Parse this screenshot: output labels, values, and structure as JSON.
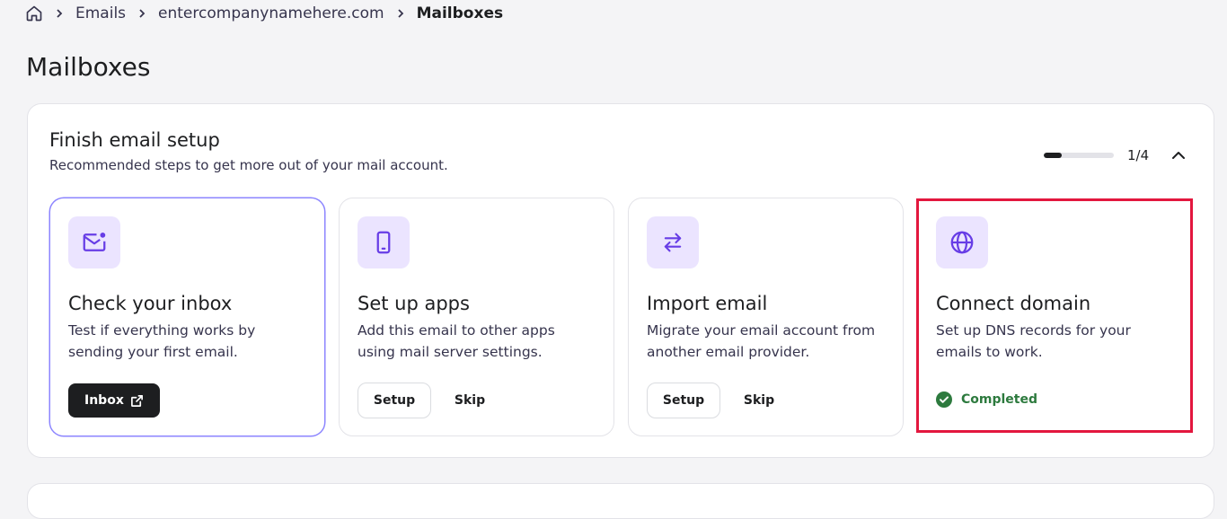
{
  "breadcrumb": {
    "items": [
      "Emails",
      "entercompanynamehere.com",
      "Mailboxes"
    ]
  },
  "page": {
    "title": "Mailboxes"
  },
  "setup": {
    "title": "Finish email setup",
    "subtitle": "Recommended steps to get more out of your mail account.",
    "progress_text": "1/4",
    "progress_fraction": 0.25,
    "cards": [
      {
        "icon": "mail-notification-icon",
        "title": "Check your inbox",
        "description": "Test if everything works by sending your first email.",
        "primary_label": "Inbox"
      },
      {
        "icon": "smartphone-icon",
        "title": "Set up apps",
        "description": "Add this email to other apps using mail server settings.",
        "setup_label": "Setup",
        "skip_label": "Skip"
      },
      {
        "icon": "swap-arrows-icon",
        "title": "Import email",
        "description": "Migrate your email account from another email provider.",
        "setup_label": "Setup",
        "skip_label": "Skip"
      },
      {
        "icon": "globe-icon",
        "title": "Connect domain",
        "description": "Set up DNS records for your emails to work.",
        "status_label": "Completed"
      }
    ]
  },
  "colors": {
    "accent": "#673de6",
    "accent_bg": "#ebe4ff",
    "success": "#2d7a3e",
    "highlight": "#e3173e"
  }
}
